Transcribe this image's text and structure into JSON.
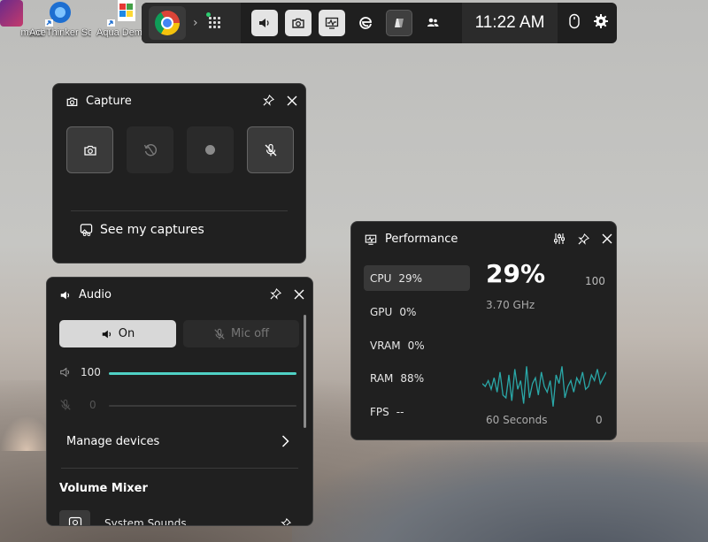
{
  "desktop": {
    "icons": [
      {
        "label": "ment"
      },
      {
        "label": "AceThinker Screen Gr..."
      },
      {
        "label": "Aqua Dem"
      }
    ]
  },
  "gamebar": {
    "time": "11:22 AM",
    "active_app": "chrome"
  },
  "capture": {
    "title": "Capture",
    "see_captures": "See my captures"
  },
  "audio": {
    "title": "Audio",
    "on_label": "On",
    "mic_off_label": "Mic off",
    "speaker_volume": "100",
    "mic_volume": "0",
    "manage_devices": "Manage devices",
    "volume_mixer": "Volume Mixer",
    "system_sounds": "System Sounds"
  },
  "performance": {
    "title": "Performance",
    "items": [
      {
        "name": "CPU",
        "value": "29%"
      },
      {
        "name": "GPU",
        "value": "0%"
      },
      {
        "name": "VRAM",
        "value": "0%"
      },
      {
        "name": "RAM",
        "value": "88%"
      },
      {
        "name": "FPS",
        "value": "--"
      }
    ],
    "big_value": "29%",
    "max_label": "100",
    "clock": "3.70 GHz",
    "span_label": "60 Seconds",
    "min_label": "0",
    "graph": [
      18,
      16,
      20,
      14,
      22,
      12,
      26,
      10,
      8,
      24,
      6,
      28,
      14,
      20,
      4,
      30,
      8,
      18,
      22,
      10,
      26,
      16,
      12,
      20,
      2,
      24,
      18,
      30,
      8,
      16,
      20,
      12,
      22,
      18,
      26,
      14,
      16,
      24,
      20,
      28,
      18,
      22,
      26
    ]
  },
  "colors": {
    "accent": "#4fd1c5",
    "graph": "#2aa8a8"
  }
}
